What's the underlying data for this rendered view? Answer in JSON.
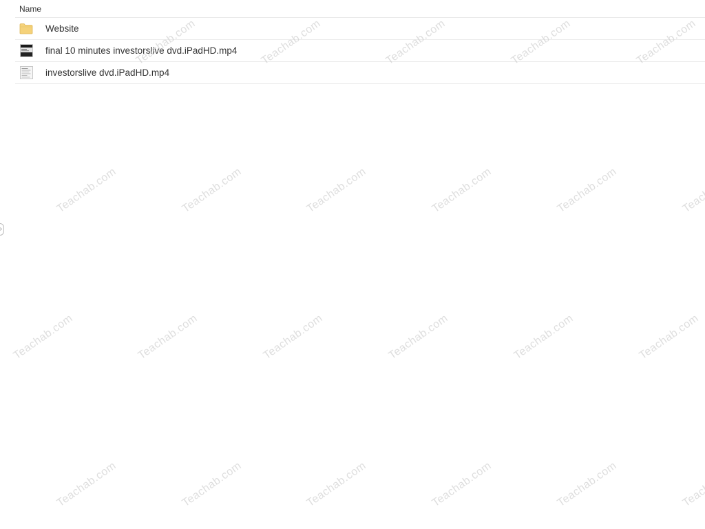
{
  "file_list": {
    "header": {
      "name_label": "Name"
    },
    "items": [
      {
        "name": "Website",
        "icon": "folder-icon"
      },
      {
        "name": "final 10 minutes investorslive dvd.iPadHD.mp4",
        "icon": "video-thumbnail-icon"
      },
      {
        "name": "investorslive dvd.iPadHD.mp4",
        "icon": "document-thumbnail-icon"
      }
    ]
  },
  "watermark": {
    "text": "Teachab.com"
  },
  "colors": {
    "folder": "#f5d27a",
    "text": "#333333",
    "divider": "#ebebeb"
  }
}
